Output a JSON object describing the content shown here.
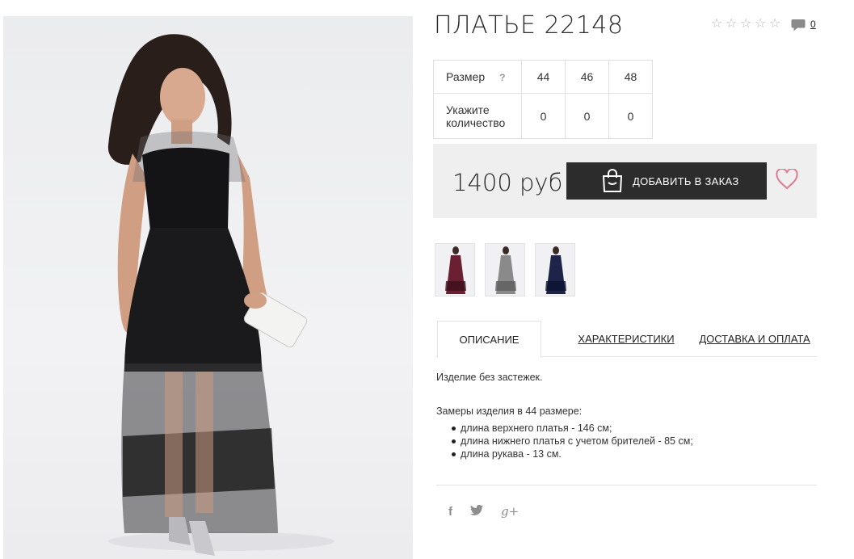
{
  "product": {
    "title": "ПЛАТЬЕ 22148",
    "rating_stars": 5,
    "rating_value": 0,
    "comments_count": "0"
  },
  "size_table": {
    "size_label": "Размер",
    "help_mark": "?",
    "sizes": [
      "44",
      "46",
      "48"
    ],
    "qty_label_line1": "Укажите",
    "qty_label_line2": "количество",
    "quantities": [
      "0",
      "0",
      "0"
    ]
  },
  "purchase": {
    "price": "1400 руб",
    "add_button_label": "ДОБАВИТЬ В ЗАКАЗ",
    "favorite_icon": "heart-icon"
  },
  "thumbnails": [
    {
      "name": "thumb-burgundy",
      "color": "#6b1f33"
    },
    {
      "name": "thumb-grey",
      "color": "#8a8a8a"
    },
    {
      "name": "thumb-navy",
      "color": "#1d2447"
    }
  ],
  "tabs": [
    {
      "label": "ОПИСАНИЕ",
      "active": true
    },
    {
      "label": "ХАРАКТЕРИСТИКИ",
      "active": false
    },
    {
      "label": "ДОСТАВКА И ОПЛАТА",
      "active": false
    }
  ],
  "description": {
    "line1": "Изделие без застежек.",
    "measurements_title": "Замеры изделия в 44 размере:",
    "items": [
      "длина верхнего платья - 146 см;",
      "длина нижнего платья с учетом брителей - 85 см;",
      "длина рукава - 13 см."
    ]
  },
  "social": {
    "facebook": "f",
    "twitter": "t",
    "google_plus": "g+"
  },
  "colors": {
    "button_bg": "#2c2c2c",
    "price_box_bg": "#efefef",
    "heart": "#e07a93"
  }
}
